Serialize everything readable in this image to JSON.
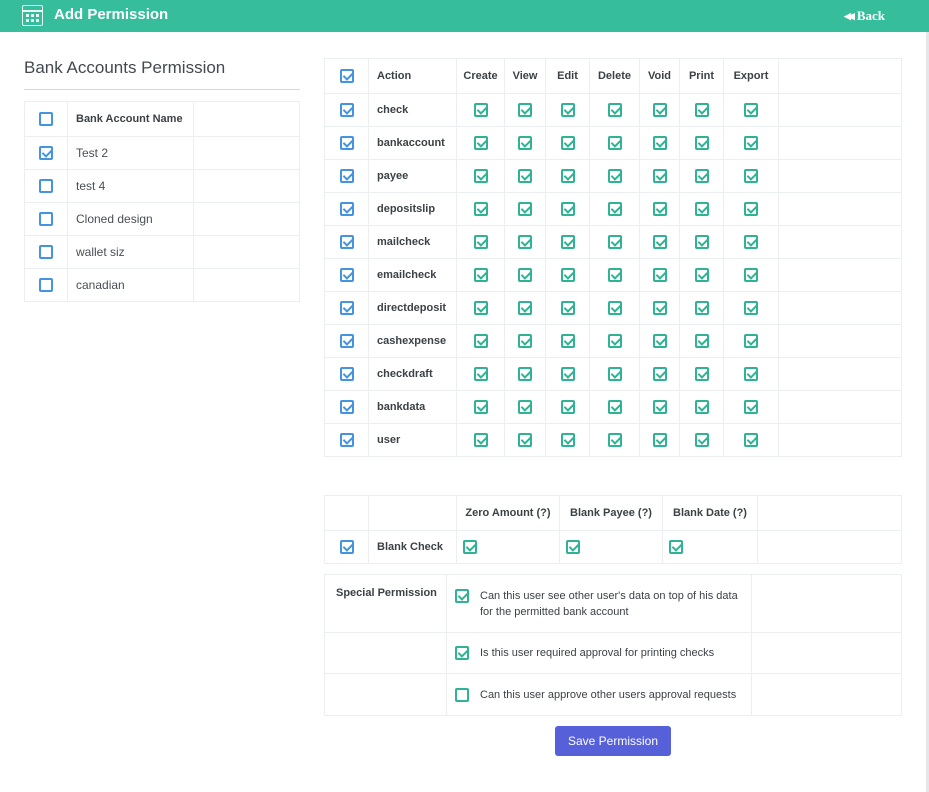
{
  "header": {
    "title": "Add Permission",
    "back_label": "Back"
  },
  "bank_accounts": {
    "title": "Bank Accounts Permission",
    "column_header": "Bank Account Name",
    "select_all_checked": false,
    "rows": [
      {
        "name": "Test 2",
        "checked": true
      },
      {
        "name": "test 4",
        "checked": false
      },
      {
        "name": "Cloned design",
        "checked": false
      },
      {
        "name": "wallet siz",
        "checked": false
      },
      {
        "name": "canadian",
        "checked": false
      }
    ]
  },
  "actions": {
    "headers": [
      "Action",
      "Create",
      "View",
      "Edit",
      "Delete",
      "Void",
      "Print",
      "Export"
    ],
    "select_all_checked": true,
    "rows": [
      {
        "name": "check",
        "checked": true,
        "perms": [
          true,
          true,
          true,
          true,
          true,
          true,
          true
        ]
      },
      {
        "name": "bankaccount",
        "checked": true,
        "perms": [
          true,
          true,
          true,
          true,
          true,
          true,
          true
        ]
      },
      {
        "name": "payee",
        "checked": true,
        "perms": [
          true,
          true,
          true,
          true,
          true,
          true,
          true
        ]
      },
      {
        "name": "depositslip",
        "checked": true,
        "perms": [
          true,
          true,
          true,
          true,
          true,
          true,
          true
        ]
      },
      {
        "name": "mailcheck",
        "checked": true,
        "perms": [
          true,
          true,
          true,
          true,
          true,
          true,
          true
        ]
      },
      {
        "name": "emailcheck",
        "checked": true,
        "perms": [
          true,
          true,
          true,
          true,
          true,
          true,
          true
        ]
      },
      {
        "name": "directdeposit",
        "checked": true,
        "perms": [
          true,
          true,
          true,
          true,
          true,
          true,
          true
        ]
      },
      {
        "name": "cashexpense",
        "checked": true,
        "perms": [
          true,
          true,
          true,
          true,
          true,
          true,
          true
        ]
      },
      {
        "name": "checkdraft",
        "checked": true,
        "perms": [
          true,
          true,
          true,
          true,
          true,
          true,
          true
        ]
      },
      {
        "name": "bankdata",
        "checked": true,
        "perms": [
          true,
          true,
          true,
          true,
          true,
          true,
          true
        ]
      },
      {
        "name": "user",
        "checked": true,
        "perms": [
          true,
          true,
          true,
          true,
          true,
          true,
          true
        ]
      }
    ]
  },
  "blank_check": {
    "headers": [
      "Zero Amount (?)",
      "Blank Payee (?)",
      "Blank Date (?)"
    ],
    "label": "Blank Check",
    "checked": true,
    "values": [
      true,
      true,
      true
    ]
  },
  "special": {
    "label": "Special Permission",
    "items": [
      {
        "text": "Can this user see other user's data on top of his data for the permitted bank account",
        "checked": true
      },
      {
        "text": "Is this user required approval for printing checks",
        "checked": true
      },
      {
        "text": "Can this user approve other users approval requests",
        "checked": false
      }
    ]
  },
  "save_label": "Save Permission",
  "colors": {
    "header_bg": "#35bd9c",
    "checkbox_blue": "#4594e0",
    "checkbox_green": "#2fb394",
    "save_button": "#5660d9"
  }
}
